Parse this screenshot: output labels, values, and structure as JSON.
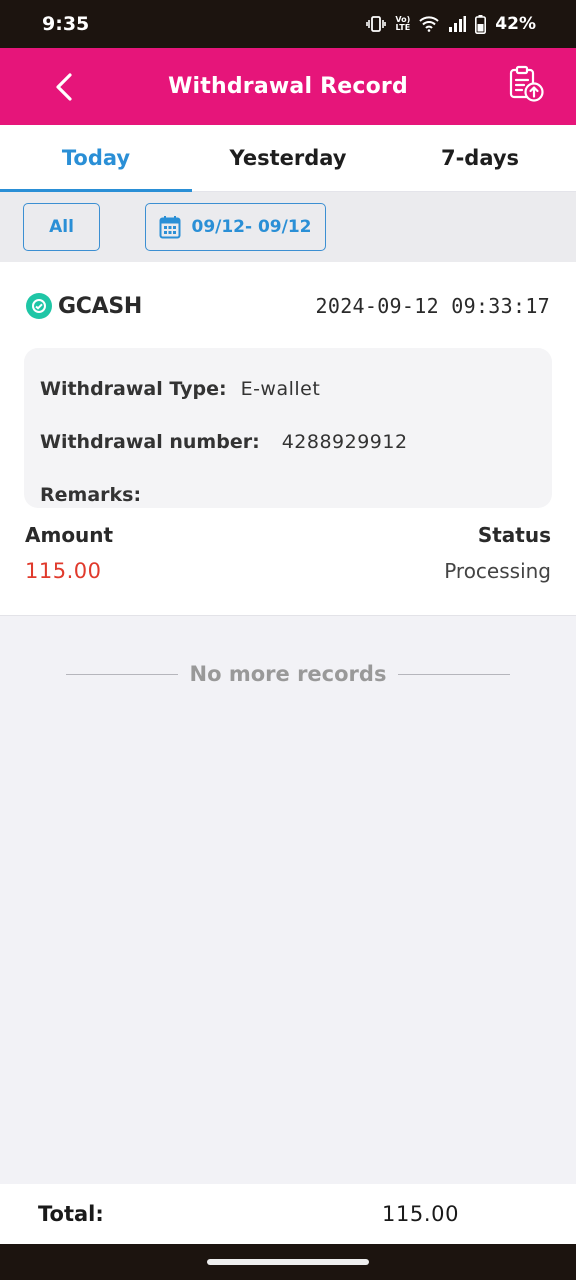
{
  "status_bar": {
    "time": "9:35",
    "volte_label_top": "Vo)",
    "volte_label_bottom": "LTE",
    "battery": "42%"
  },
  "header": {
    "title": "Withdrawal Record",
    "back_icon": "chevron-left-icon",
    "action_icon": "clipboard-upload-icon"
  },
  "tabs": [
    {
      "label": "Today",
      "active": true
    },
    {
      "label": "Yesterday",
      "active": false
    },
    {
      "label": "7-days",
      "active": false
    }
  ],
  "filters": {
    "type": "All",
    "date_range": "09/12- 09/12",
    "date_icon": "calendar-icon"
  },
  "record": {
    "provider": "GCASH",
    "provider_icon": "gcash-icon",
    "datetime": "2024-09-12 09:33:17",
    "type_label": "Withdrawal Type:",
    "type_value": "E-wallet",
    "number_label": "Withdrawal number:",
    "number_value": "4288929912",
    "remarks_label": "Remarks:",
    "remarks_value": "",
    "amount_label": "Amount",
    "amount_value": "115.00",
    "status_label": "Status",
    "status_value": "Processing"
  },
  "list_end": "No more records",
  "total": {
    "label": "Total:",
    "value": "115.00"
  },
  "colors": {
    "header": "#e6157a",
    "accent": "#2a8fd6",
    "amount": "#e03a2c",
    "gcash": "#1fc6a6"
  }
}
